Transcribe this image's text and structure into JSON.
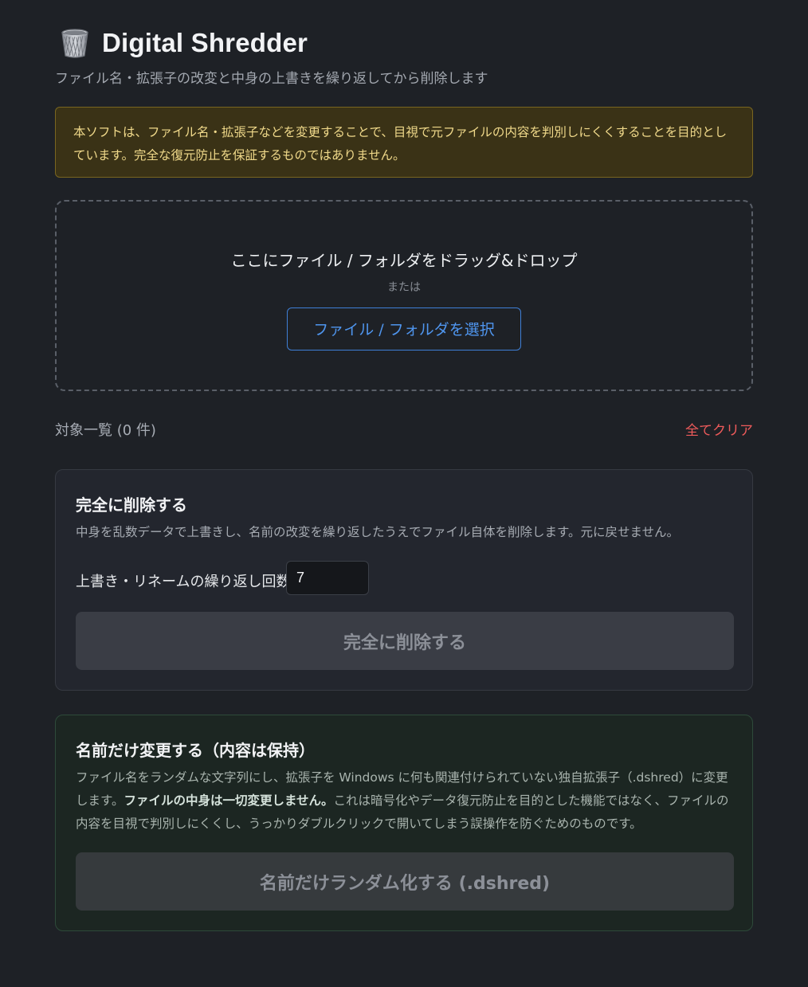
{
  "header": {
    "icon": "wastebasket-icon",
    "title": "Digital Shredder",
    "subtitle": "ファイル名・拡張子の改変と中身の上書きを繰り返してから削除します"
  },
  "warning": {
    "text": "本ソフトは、ファイル名・拡張子などを変更することで、目視で元ファイルの内容を判別しにくくすることを目的としています。完全な復元防止を保証するものではありません。"
  },
  "dropzone": {
    "main_text": "ここにファイル / フォルダをドラッグ&ドロップ",
    "or_text": "または",
    "select_button": "ファイル / フォルダを選択"
  },
  "list": {
    "count_label": "対象一覧 (0 件)",
    "clear_label": "全てクリア"
  },
  "delete_card": {
    "title": "完全に削除する",
    "description": "中身を乱数データで上書きし、名前の改変を繰り返したうえでファイル自体を削除します。元に戻せません。",
    "repeat_label": "上書き・リネームの繰り返し回数",
    "repeat_value": "7",
    "button": "完全に削除する"
  },
  "rename_card": {
    "title": "名前だけ変更する（内容は保持）",
    "description_part1": "ファイル名をランダムな文字列にし、拡張子を Windows に何も関連付けられていない独自拡張子（.dshred）に変更します。",
    "description_bold": "ファイルの中身は一切変更しません。",
    "description_part2": "これは暗号化やデータ復元防止を目的とした機能ではなく、ファイルの内容を目視で判別しにくくし、うっかりダブルクリックで開いてしまう誤操作を防ぐためのものです。",
    "button": "名前だけランダム化する (.dshred)"
  },
  "colors": {
    "background": "#1e2126",
    "warning_bg": "#3a3216",
    "warning_text": "#f0d98a",
    "accent_blue": "#4f95ee",
    "danger_red": "#ef5b5b"
  }
}
